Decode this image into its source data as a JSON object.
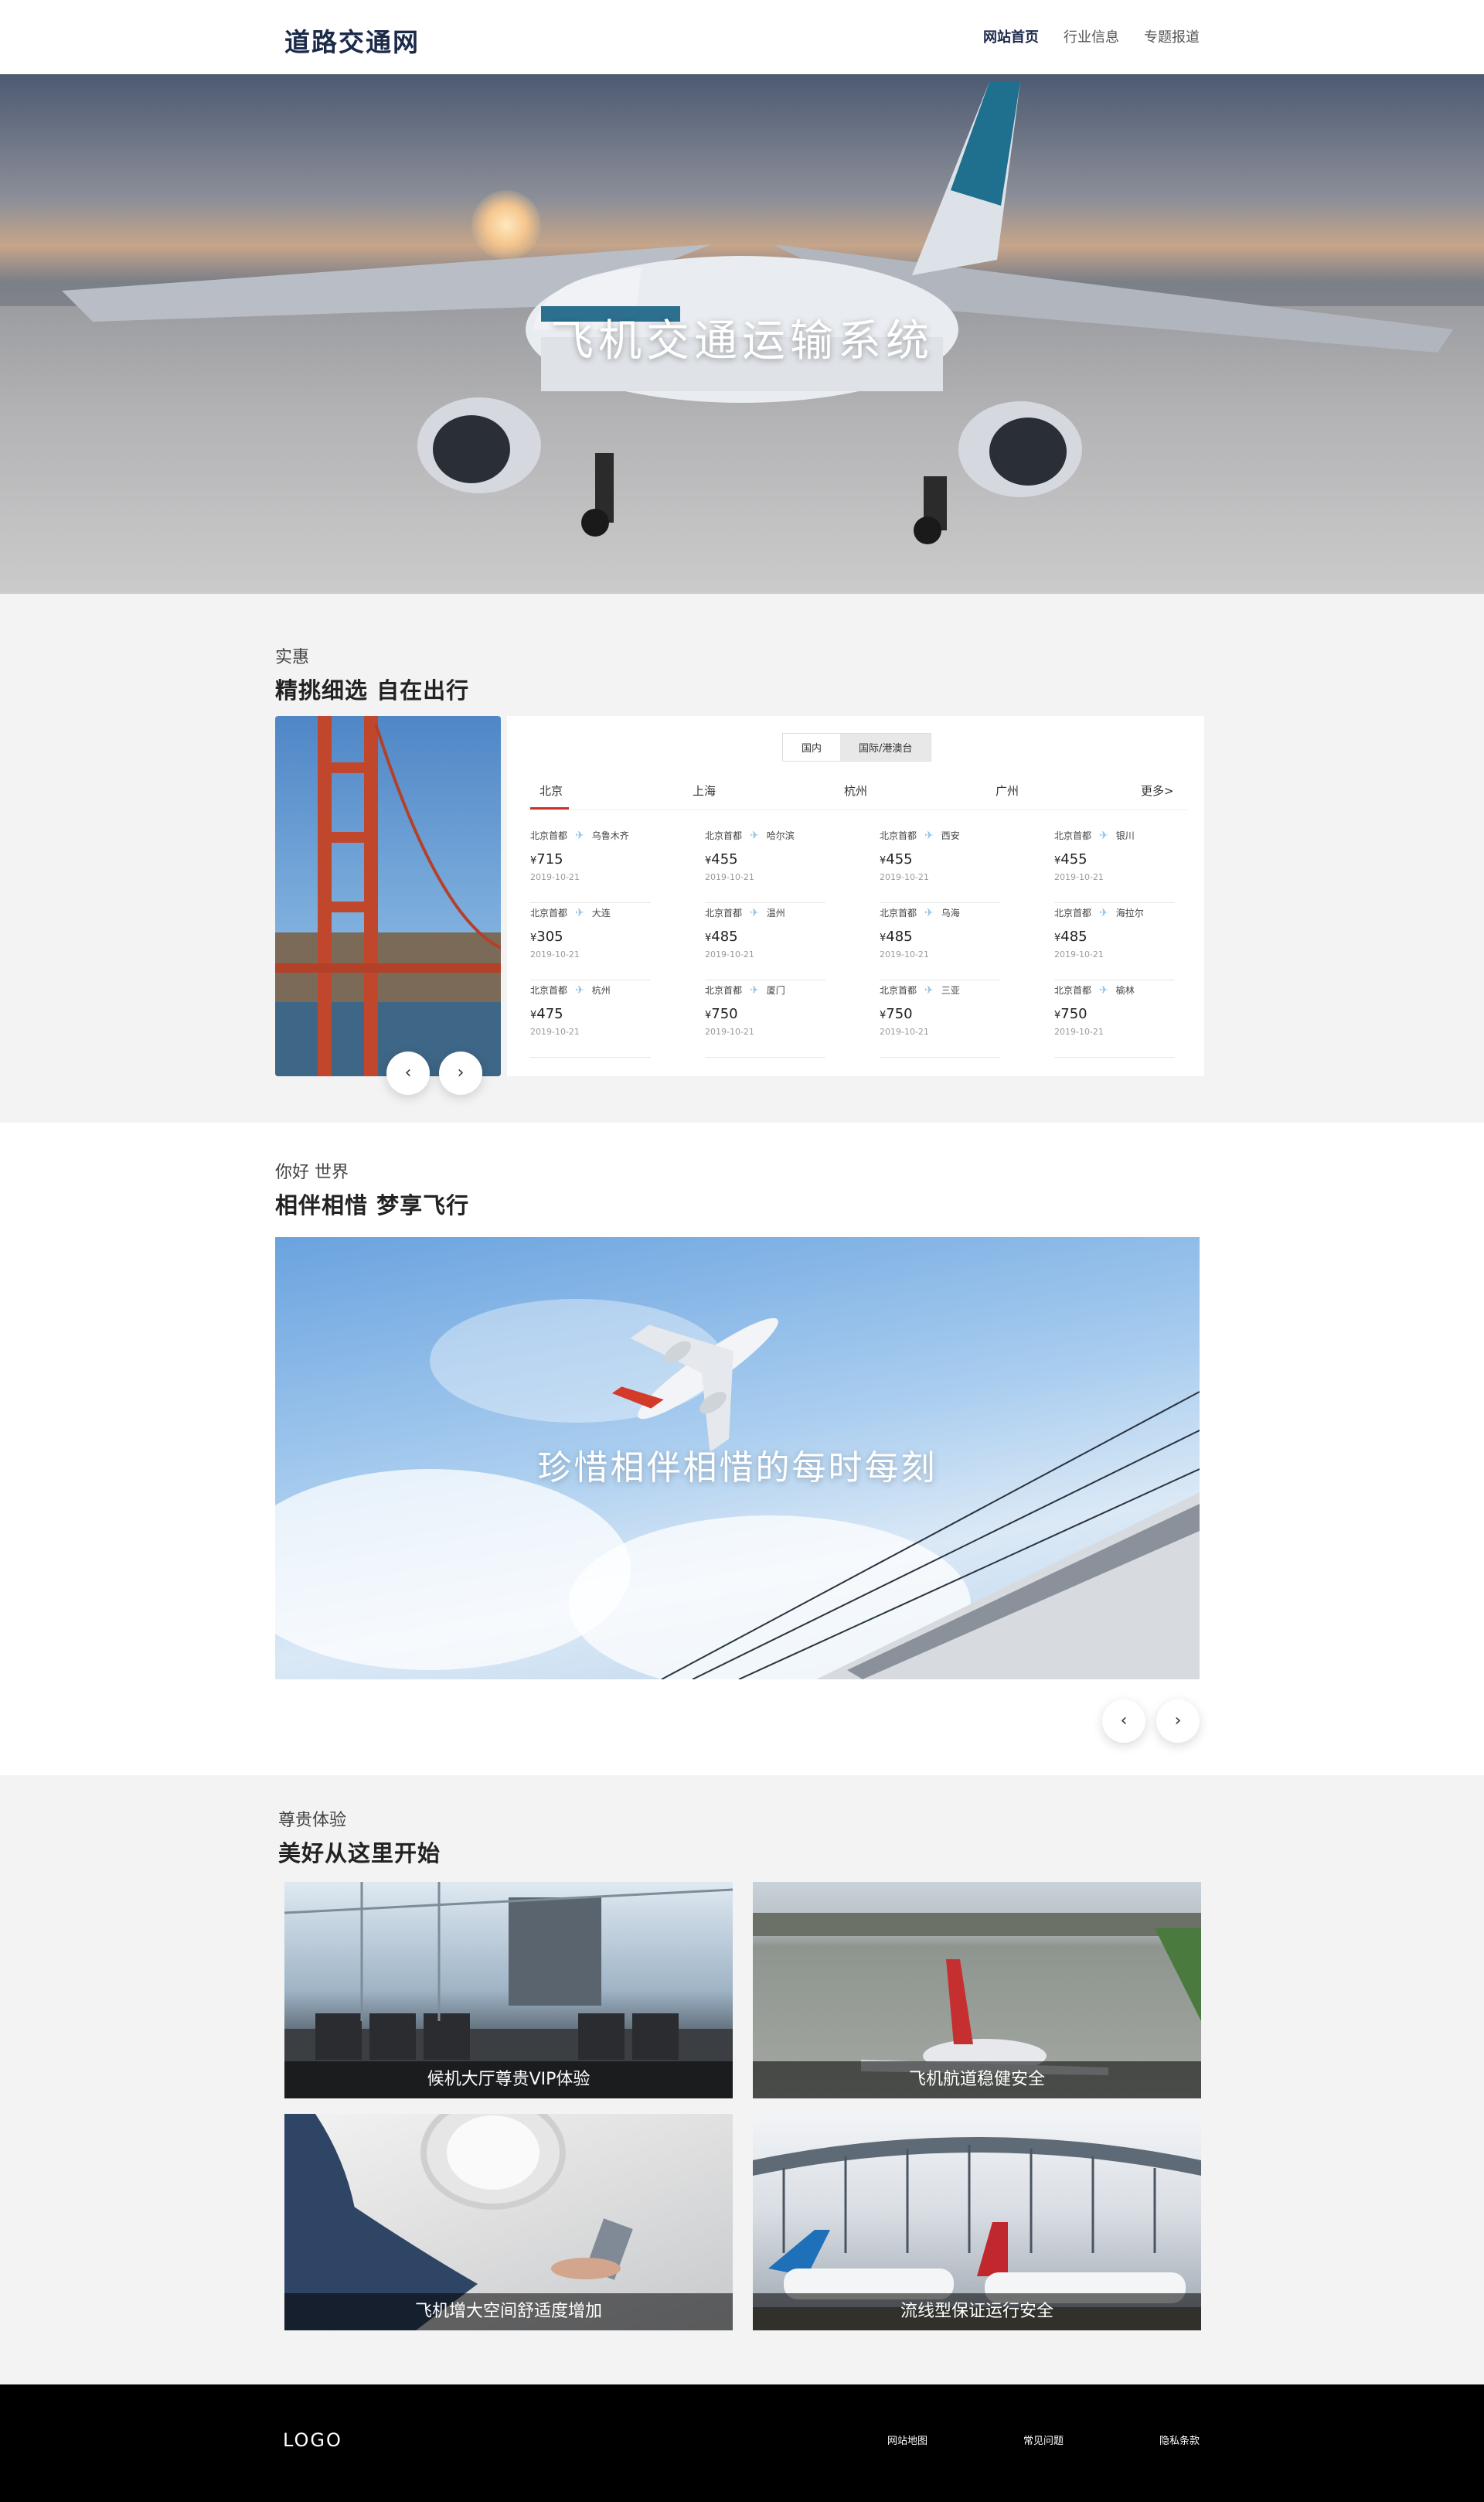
{
  "nav": {
    "brand": "道路交通网",
    "links": [
      "网站首页",
      "行业信息",
      "专题报道"
    ]
  },
  "hero": {
    "title": "飞机交通运输系统"
  },
  "deals": {
    "kicker": "实惠",
    "title": "精挑细选 自在出行",
    "toggle": [
      "国内",
      "国际/港澳台"
    ],
    "cities": [
      "北京",
      "上海",
      "杭州",
      "广州",
      "更多>"
    ],
    "routes": [
      {
        "from": "北京首都",
        "to": "乌鲁木齐",
        "price": "715",
        "date": "2019-10-21"
      },
      {
        "from": "北京首都",
        "to": "哈尔滨",
        "price": "455",
        "date": "2019-10-21"
      },
      {
        "from": "北京首都",
        "to": "西安",
        "price": "455",
        "date": "2019-10-21"
      },
      {
        "from": "北京首都",
        "to": "银川",
        "price": "455",
        "date": "2019-10-21"
      },
      {
        "from": "北京首都",
        "to": "大连",
        "price": "305",
        "date": "2019-10-21"
      },
      {
        "from": "北京首都",
        "to": "温州",
        "price": "485",
        "date": "2019-10-21"
      },
      {
        "from": "北京首都",
        "to": "乌海",
        "price": "485",
        "date": "2019-10-21"
      },
      {
        "from": "北京首都",
        "to": "海拉尔",
        "price": "485",
        "date": "2019-10-21"
      },
      {
        "from": "北京首都",
        "to": "杭州",
        "price": "475",
        "date": "2019-10-21"
      },
      {
        "from": "北京首都",
        "to": "厦门",
        "price": "750",
        "date": "2019-10-21"
      },
      {
        "from": "北京首都",
        "to": "三亚",
        "price": "750",
        "date": "2019-10-21"
      },
      {
        "from": "北京首都",
        "to": "榆林",
        "price": "750",
        "date": "2019-10-21"
      }
    ],
    "currency": "¥"
  },
  "hello": {
    "kicker": "你好 世界",
    "title": "相伴相惜 梦享飞行",
    "banner_title": "珍惜相伴相惜的每时每刻"
  },
  "experience": {
    "kicker": "尊贵体验",
    "title": "美好从这里开始",
    "cards": [
      "候机大厅尊贵VIP体验",
      "飞机航道稳健安全",
      "飞机增大空间舒适度增加",
      "流线型保证运行安全"
    ]
  },
  "footer": {
    "logo": "LOGO",
    "links": [
      "网站地图",
      "常见问题",
      "隐私条款"
    ]
  },
  "icons": {
    "prev": "chevron-left-icon",
    "next": "chevron-right-icon",
    "route": "airplane-icon"
  },
  "colors": {
    "accent": "#c9302c",
    "brand": "#1c2a4a",
    "footer_bg": "#000000"
  }
}
